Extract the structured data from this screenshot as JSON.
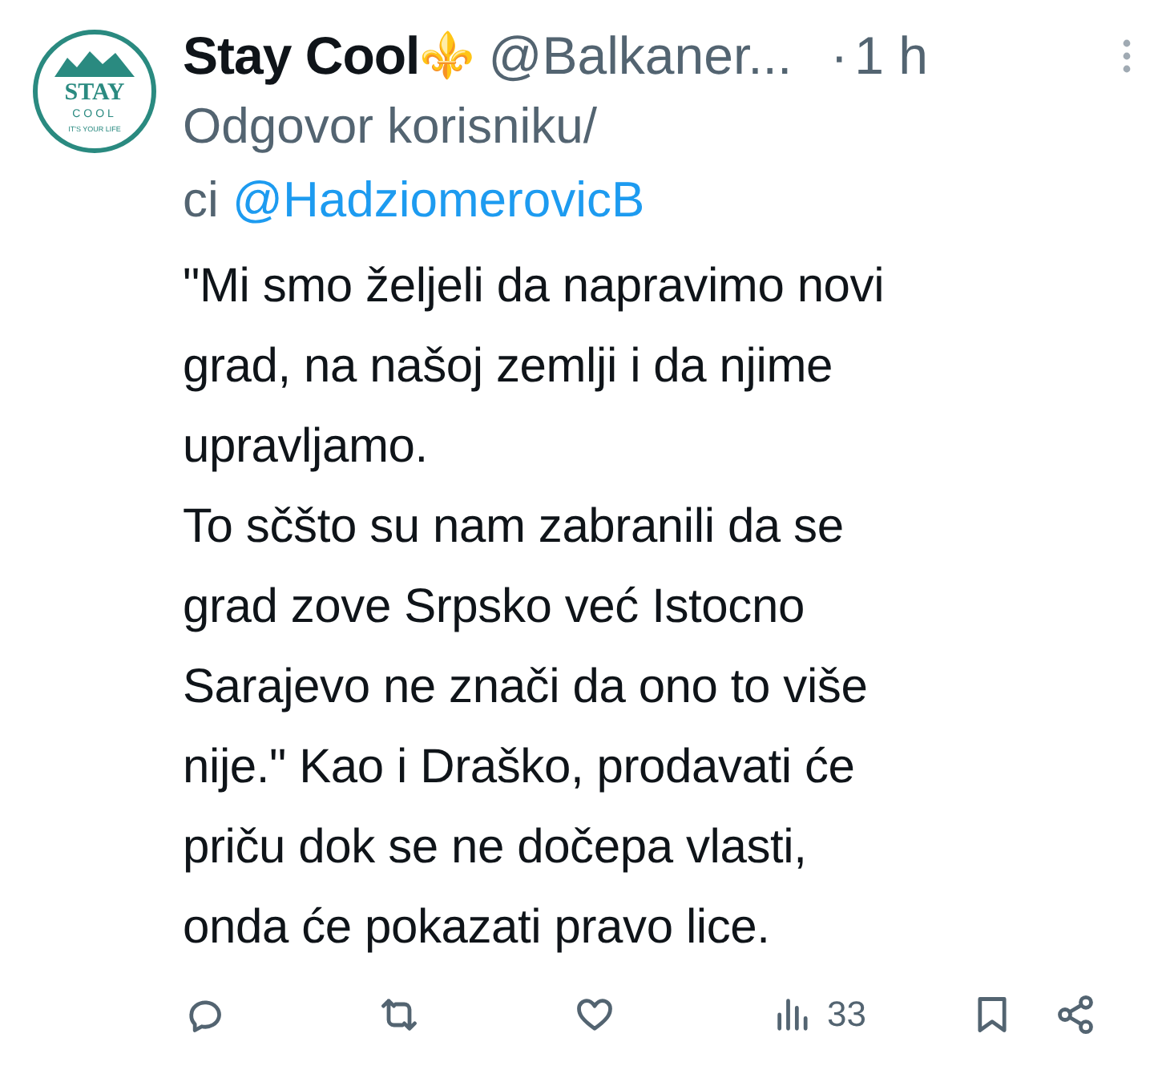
{
  "avatar": {
    "lines": [
      "STAY",
      "COOL",
      "IT'S YOUR LIFE"
    ]
  },
  "author": {
    "name": "Stay Cool",
    "emoji": "⚜️",
    "handle": "@Balkaner...",
    "separator": "·",
    "time": "1 h"
  },
  "reply_to": {
    "prefix": "Odgovor korisniku/",
    "continuation": "ci",
    "mention": "@HadziomerovicB"
  },
  "body": "\"Mi smo željeli da napravimo novi\ngrad, na našoj zemlji i da njime\nupravljamo.\nTo sčšto su nam zabranili da se\ngrad zove Srpsko već Istocno\nSarajevo ne znači da ono to više\nnije.\" Kao i Draško, prodavati će\npriču dok se ne dočepa vlasti,\nonda će pokazati pravo lice.",
  "actions": [
    {
      "kind": "reply"
    },
    {
      "kind": "retweet"
    },
    {
      "kind": "like"
    },
    {
      "kind": "views",
      "count": "33"
    },
    {
      "kind": "bookmark"
    },
    {
      "kind": "share"
    }
  ]
}
